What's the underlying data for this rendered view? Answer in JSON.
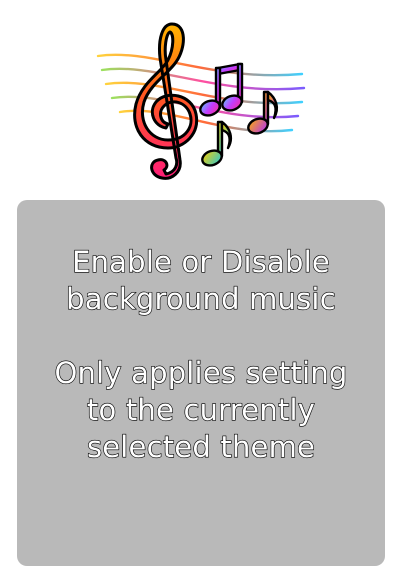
{
  "header": {
    "icon": "music-notes-icon"
  },
  "panel": {
    "line1": "Enable or Disable",
    "line2": "background music",
    "line3": "Only applies setting",
    "line4": "to the currently",
    "line5": "selected theme"
  },
  "colors": {
    "panel_background": "#b9b9b9",
    "text": "#ffffff",
    "text_outline": "#000000"
  }
}
